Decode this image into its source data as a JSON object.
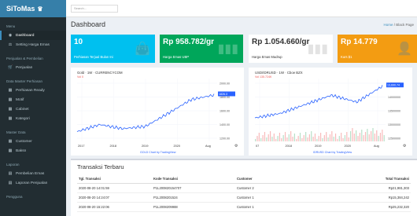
{
  "brand": {
    "name": "SiToMas",
    "icon": "crown-icon"
  },
  "sidebar": {
    "sections": [
      {
        "header": "Menu",
        "items": [
          {
            "label": "Dashboard",
            "icon": "dashboard-icon",
            "active": true
          },
          {
            "label": "Setting Harga Emas",
            "icon": "scale-icon"
          }
        ]
      },
      {
        "header": "Penjualan & Pembelian",
        "items": [
          {
            "label": "Penjualan",
            "icon": "cart-icon"
          }
        ]
      },
      {
        "header": "Data Master Perhiasan",
        "items": [
          {
            "label": "Perhiasan Ready",
            "icon": "table-icon"
          },
          {
            "label": "Motif",
            "icon": "table-icon"
          },
          {
            "label": "Cabinet",
            "icon": "table-icon"
          },
          {
            "label": "Kategori",
            "icon": "table-icon"
          }
        ]
      },
      {
        "header": "Master Data",
        "items": [
          {
            "label": "Customer",
            "icon": "table-icon"
          },
          {
            "label": "Baksn",
            "icon": "table-icon"
          }
        ]
      },
      {
        "header": "Laporan",
        "items": [
          {
            "label": "Pembelian Emas",
            "icon": "report-icon"
          },
          {
            "label": "Laporan Penjualan",
            "icon": "report-icon"
          }
        ]
      },
      {
        "header": "Pengguna",
        "items": []
      }
    ]
  },
  "topbar": {
    "search_placeholder": "Search..."
  },
  "page": {
    "title": "Dashboard",
    "breadcrumb_home": "Home",
    "breadcrumb_sep": " / ",
    "breadcrumb_current": "Black Page"
  },
  "stat_boxes": [
    {
      "value": "10",
      "label": "Perhiasan Terjual Bulan Ini",
      "icon": "bag-icon",
      "color": "#00c0ef"
    },
    {
      "value": "Rp 958.782/gr",
      "label": "Harga Emas UBP",
      "icon": "bar-chart-icon",
      "color": "#00a65a"
    },
    {
      "value": "Rp 1.054.660/gr",
      "label": "Harga Emas Madrup",
      "icon": "bar-chart-icon",
      "color": "#ffffff"
    },
    {
      "value": "Rp 14.779",
      "label": "Kurs $1",
      "icon": "user-icon",
      "color": "#f39c12"
    }
  ],
  "charts": [
    {
      "symbol": "Gold · 1W · CURRENCYCOM",
      "sub": "Vol 0",
      "price_tag": "1826.3",
      "y_ticks": [
        "2000.00",
        "1800.00",
        "1600.00",
        "1400.00",
        "1200.00"
      ],
      "x_ticks": [
        "2017",
        "2018",
        "2019",
        "2020",
        "Aug"
      ],
      "footer": "GOLD Chart by TradingView",
      "line_color": "#2962ff",
      "chart_data": {
        "type": "line",
        "title": "Gold · 1W · CURRENCYCOM",
        "x": [
          "2017",
          "2018",
          "2019",
          "2020",
          "Aug"
        ],
        "y": [
          1210,
          1330,
          1260,
          1300,
          1520,
          1750,
          1826
        ],
        "ylim": [
          1100,
          2050
        ]
      }
    },
    {
      "symbol": "USD/IDRUSD · 1W · Cboe BZX",
      "sub": "Vol 135.724K",
      "price_tag": "13,690.74",
      "y_ticks": [
        "14500000",
        "14000000",
        "13500000",
        "13000000",
        "12500000"
      ],
      "x_ticks": [
        "07",
        "2018",
        "2019",
        "2020",
        "Aug"
      ],
      "footer": "IDRUSD Chart by TradingView",
      "line_color": "#2962ff",
      "chart_data": {
        "type": "line",
        "title": "USD/IDRUSD · 1W · Cboe BZX",
        "x": [
          "07",
          "2018",
          "2019",
          "2020",
          "Aug"
        ],
        "y": [
          13200000,
          13400000,
          13800000,
          14200000,
          13900000,
          14600000
        ],
        "ylim": [
          12300000,
          14800000
        ]
      }
    }
  ],
  "transactions": {
    "title": "Transaksi Terbaru",
    "columns": [
      "Tgl. Transaksi",
      "Kode Transaksi",
      "Customer",
      "Total Transaksi"
    ],
    "rows": [
      [
        "2020-08-20 14:01:59",
        "P1L200820154707",
        "Customer 2",
        "Rp21,981,303"
      ],
      [
        "2020-08-20 14:24:07",
        "P1L2008201524",
        "Customer 1",
        "Rp15,384,242"
      ],
      [
        "2020-08-20 15:22:06",
        "P1L2008209988",
        "Customer 1",
        "Rp25,232,320"
      ]
    ]
  }
}
